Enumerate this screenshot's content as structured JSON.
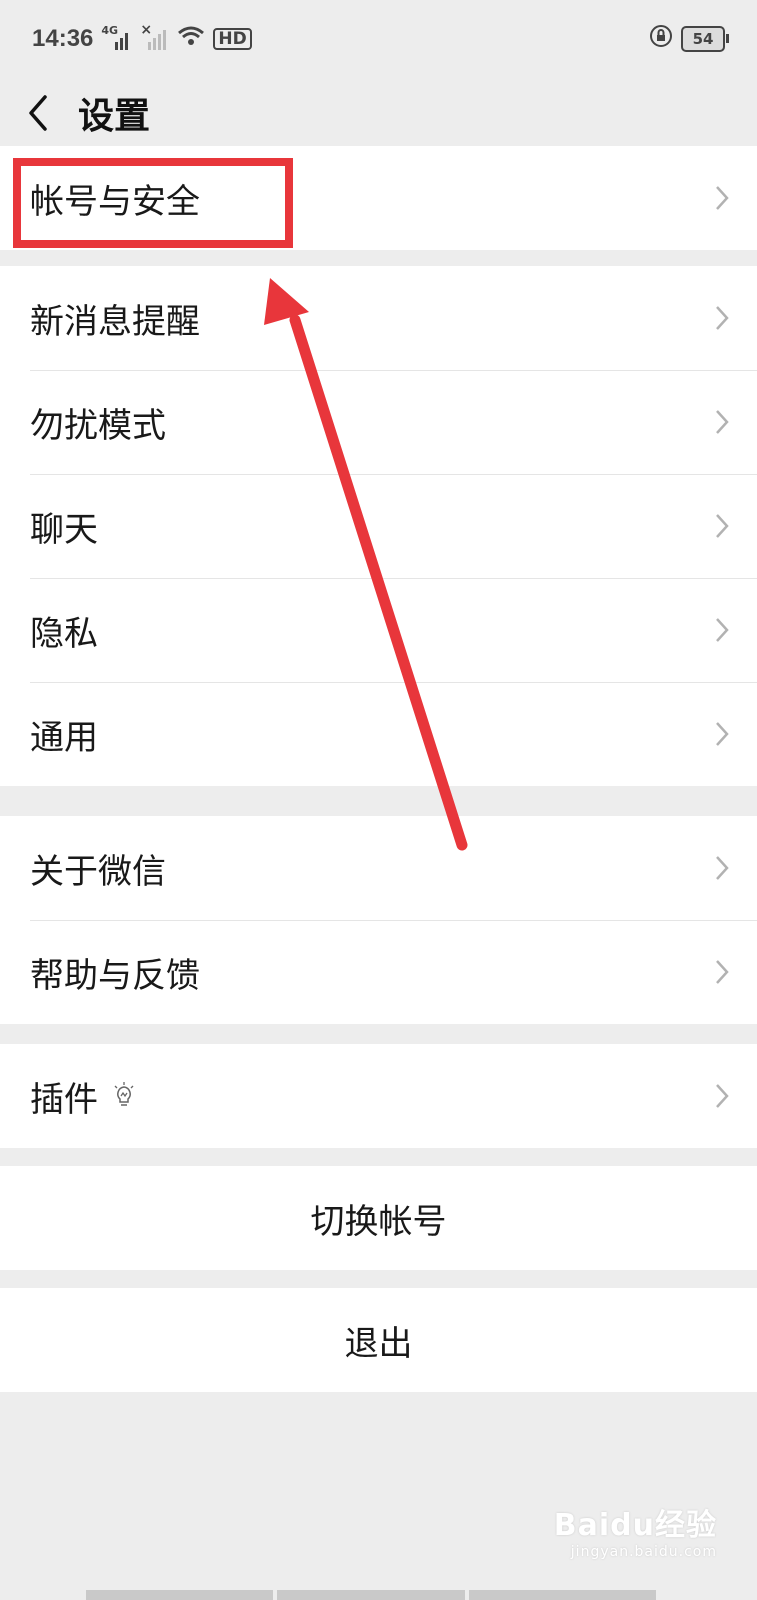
{
  "status_bar": {
    "time": "14:36",
    "network_badge": "4G",
    "signal_x": "×",
    "hd_label": "HD",
    "battery": "54"
  },
  "nav": {
    "title": "设置"
  },
  "sections": {
    "account": {
      "items": [
        {
          "label": "帐号与安全"
        }
      ]
    },
    "prefs": {
      "items": [
        {
          "label": "新消息提醒"
        },
        {
          "label": "勿扰模式"
        },
        {
          "label": "聊天"
        },
        {
          "label": "隐私"
        },
        {
          "label": "通用"
        }
      ]
    },
    "about": {
      "items": [
        {
          "label": "关于微信"
        },
        {
          "label": "帮助与反馈"
        }
      ]
    },
    "plugins": {
      "items": [
        {
          "label": "插件"
        }
      ]
    }
  },
  "actions": {
    "switch_account": "切换帐号",
    "logout": "退出"
  },
  "watermark": {
    "brand": "Baidu经验",
    "url": "jingyan.baidu.com"
  },
  "colors": {
    "annotation": "#e8363b",
    "background": "#ededed"
  }
}
